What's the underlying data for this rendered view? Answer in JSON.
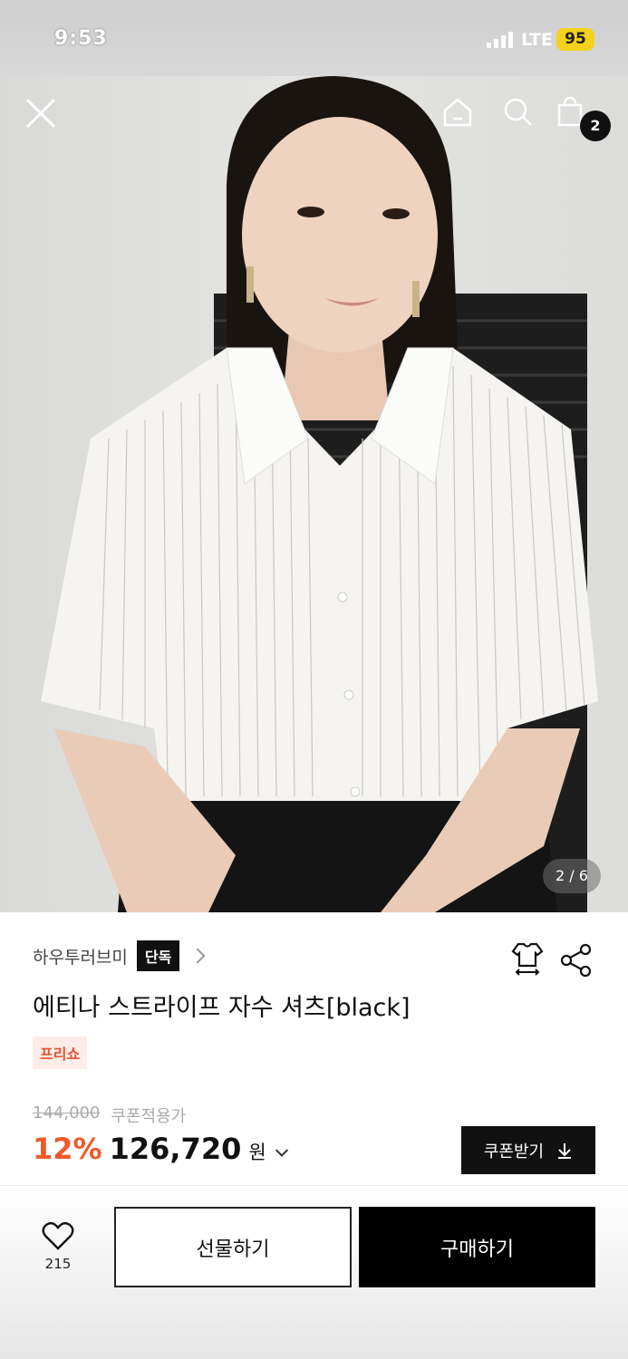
{
  "status_bar": {
    "time": "9:53",
    "network": "LTE",
    "battery": "95",
    "battery_color": "#f4d21b"
  },
  "hero": {
    "cart_count": "2",
    "pager": "2 / 6"
  },
  "product": {
    "brand": "하우투러브미",
    "brand_tag": "단독",
    "title": "에티나 스트라이프 자수 셔츠[black]",
    "badge": "프리쇼",
    "original_price": "144,000",
    "coupon_note": "쿠폰적용가",
    "discount": "12%",
    "price": "126,720",
    "currency": "원",
    "coupon_button": "쿠폰받기"
  },
  "bottom_bar": {
    "like_count": "215",
    "gift_label": "선물하기",
    "buy_label": "구매하기"
  },
  "colors": {
    "accent": "#f05a28",
    "badge_bg": "#fdece8"
  }
}
